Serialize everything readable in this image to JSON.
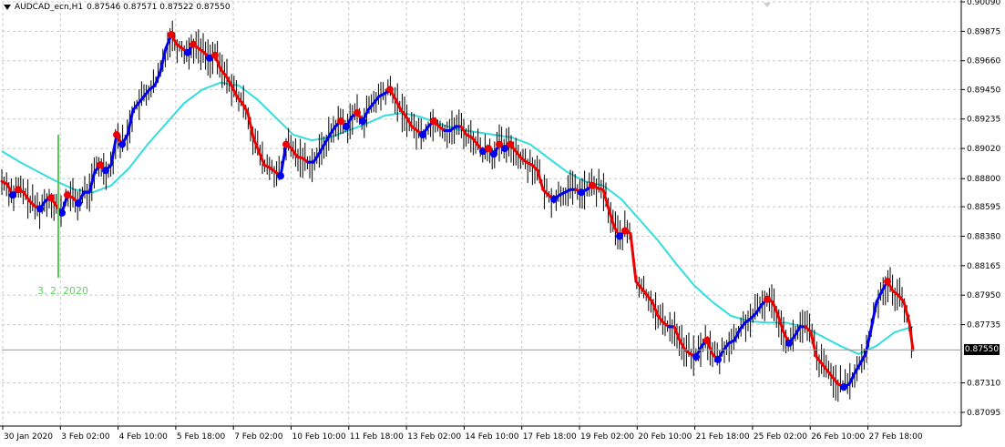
{
  "header": {
    "symbol_label": "AUDCAD_ecn,H1",
    "ohlc": "0.87546 0.87571 0.87522 0.87550"
  },
  "marker": {
    "label": "3. 2. 2020"
  },
  "current_price": "0.87550",
  "colors": {
    "up_trend": "#0000ee",
    "down_trend": "#ee0000",
    "bars": "#000000",
    "moving_average": "#33dddd",
    "marker_line": "#55cc55",
    "grid": "#c8c8c8",
    "axis": "#000000"
  },
  "chart_data": {
    "type": "line",
    "title": "",
    "xlabel": "",
    "ylabel": "",
    "ylim": [
      0.86995,
      0.9009
    ],
    "y_ticks": [
      "0.90090",
      "0.89875",
      "0.89660",
      "0.89450",
      "0.89235",
      "0.89020",
      "0.88800",
      "0.88595",
      "0.88380",
      "0.88165",
      "0.87950",
      "0.87735",
      "0.87310",
      "0.87095"
    ],
    "x_ticks": [
      "30 Jan 2020",
      "3 Feb 02:00",
      "4 Feb 10:00",
      "5 Feb 18:00",
      "7 Feb 02:00",
      "10 Feb 10:00",
      "11 Feb 18:00",
      "13 Feb 02:00",
      "14 Feb 10:00",
      "17 Feb 18:00",
      "19 Feb 02:00",
      "20 Feb 10:00",
      "21 Feb 18:00",
      "25 Feb 02:00",
      "26 Feb 10:00",
      "27 Feb 18:00"
    ],
    "price_points": [
      [
        0,
        0.8878
      ],
      [
        6,
        0.8876
      ],
      [
        12,
        0.8868
      ],
      [
        18,
        0.8872
      ],
      [
        24,
        0.887
      ],
      [
        30,
        0.8864
      ],
      [
        36,
        0.886
      ],
      [
        42,
        0.8858
      ],
      [
        48,
        0.8864
      ],
      [
        54,
        0.8866
      ],
      [
        60,
        0.886
      ],
      [
        66,
        0.8855
      ],
      [
        72,
        0.8868
      ],
      [
        78,
        0.8866
      ],
      [
        84,
        0.8862
      ],
      [
        90,
        0.887
      ],
      [
        96,
        0.887
      ],
      [
        102,
        0.8885
      ],
      [
        108,
        0.889
      ],
      [
        114,
        0.8886
      ],
      [
        120,
        0.889
      ],
      [
        126,
        0.8912
      ],
      [
        132,
        0.8905
      ],
      [
        138,
        0.8912
      ],
      [
        144,
        0.893
      ],
      [
        150,
        0.8935
      ],
      [
        156,
        0.894
      ],
      [
        162,
        0.8945
      ],
      [
        168,
        0.8948
      ],
      [
        174,
        0.8958
      ],
      [
        180,
        0.8975
      ],
      [
        186,
        0.8985
      ],
      [
        192,
        0.8978
      ],
      [
        198,
        0.8975
      ],
      [
        204,
        0.8972
      ],
      [
        210,
        0.8978
      ],
      [
        216,
        0.8975
      ],
      [
        222,
        0.8972
      ],
      [
        228,
        0.8968
      ],
      [
        234,
        0.897
      ],
      [
        240,
        0.896
      ],
      [
        246,
        0.8955
      ],
      [
        252,
        0.8948
      ],
      [
        258,
        0.894
      ],
      [
        264,
        0.8935
      ],
      [
        270,
        0.8928
      ],
      [
        276,
        0.891
      ],
      [
        282,
        0.89
      ],
      [
        288,
        0.889
      ],
      [
        294,
        0.8888
      ],
      [
        300,
        0.8885
      ],
      [
        306,
        0.8882
      ],
      [
        312,
        0.8905
      ],
      [
        318,
        0.8902
      ],
      [
        324,
        0.8896
      ],
      [
        330,
        0.8895
      ],
      [
        336,
        0.8892
      ],
      [
        342,
        0.8892
      ],
      [
        348,
        0.8898
      ],
      [
        354,
        0.8905
      ],
      [
        360,
        0.8912
      ],
      [
        366,
        0.8918
      ],
      [
        372,
        0.8922
      ],
      [
        378,
        0.8918
      ],
      [
        384,
        0.8925
      ],
      [
        390,
        0.8928
      ],
      [
        396,
        0.8922
      ],
      [
        402,
        0.893
      ],
      [
        408,
        0.8935
      ],
      [
        414,
        0.894
      ],
      [
        420,
        0.8942
      ],
      [
        426,
        0.8945
      ],
      [
        432,
        0.8938
      ],
      [
        438,
        0.893
      ],
      [
        444,
        0.8925
      ],
      [
        450,
        0.8918
      ],
      [
        456,
        0.8915
      ],
      [
        462,
        0.8912
      ],
      [
        468,
        0.8918
      ],
      [
        474,
        0.8922
      ],
      [
        480,
        0.8918
      ],
      [
        486,
        0.8915
      ],
      [
        492,
        0.8915
      ],
      [
        498,
        0.8918
      ],
      [
        504,
        0.8918
      ],
      [
        510,
        0.8912
      ],
      [
        516,
        0.891
      ],
      [
        522,
        0.8905
      ],
      [
        528,
        0.89
      ],
      [
        534,
        0.8902
      ],
      [
        540,
        0.8898
      ],
      [
        546,
        0.8905
      ],
      [
        552,
        0.8902
      ],
      [
        558,
        0.8905
      ],
      [
        564,
        0.89
      ],
      [
        570,
        0.8895
      ],
      [
        576,
        0.8892
      ],
      [
        582,
        0.889
      ],
      [
        588,
        0.8886
      ],
      [
        594,
        0.8872
      ],
      [
        600,
        0.8868
      ],
      [
        606,
        0.8865
      ],
      [
        612,
        0.8868
      ],
      [
        618,
        0.887
      ],
      [
        624,
        0.8872
      ],
      [
        630,
        0.8872
      ],
      [
        636,
        0.887
      ],
      [
        642,
        0.8872
      ],
      [
        648,
        0.8875
      ],
      [
        654,
        0.8873
      ],
      [
        660,
        0.8872
      ],
      [
        666,
        0.8858
      ],
      [
        672,
        0.8845
      ],
      [
        678,
        0.8838
      ],
      [
        684,
        0.8842
      ],
      [
        690,
        0.884
      ],
      [
        696,
        0.8805
      ],
      [
        702,
        0.88
      ],
      [
        708,
        0.8795
      ],
      [
        714,
        0.879
      ],
      [
        720,
        0.878
      ],
      [
        726,
        0.8775
      ],
      [
        732,
        0.8772
      ],
      [
        738,
        0.8772
      ],
      [
        744,
        0.8762
      ],
      [
        750,
        0.8755
      ],
      [
        756,
        0.8752
      ],
      [
        762,
        0.875
      ],
      [
        768,
        0.8758
      ],
      [
        774,
        0.8762
      ],
      [
        780,
        0.8752
      ],
      [
        786,
        0.8748
      ],
      [
        792,
        0.8755
      ],
      [
        798,
        0.876
      ],
      [
        804,
        0.8762
      ],
      [
        810,
        0.877
      ],
      [
        816,
        0.8775
      ],
      [
        822,
        0.8778
      ],
      [
        828,
        0.8782
      ],
      [
        834,
        0.8788
      ],
      [
        840,
        0.8792
      ],
      [
        846,
        0.879
      ],
      [
        852,
        0.878
      ],
      [
        858,
        0.8768
      ],
      [
        864,
        0.876
      ],
      [
        870,
        0.8765
      ],
      [
        876,
        0.8772
      ],
      [
        882,
        0.8772
      ],
      [
        888,
        0.8768
      ],
      [
        894,
        0.875
      ],
      [
        900,
        0.8745
      ],
      [
        906,
        0.874
      ],
      [
        912,
        0.8735
      ],
      [
        918,
        0.873
      ],
      [
        924,
        0.8728
      ],
      [
        930,
        0.873
      ],
      [
        936,
        0.8738
      ],
      [
        942,
        0.8745
      ],
      [
        948,
        0.8752
      ],
      [
        954,
        0.877
      ],
      [
        960,
        0.879
      ],
      [
        966,
        0.8798
      ],
      [
        972,
        0.8805
      ],
      [
        978,
        0.8798
      ],
      [
        984,
        0.8795
      ],
      [
        990,
        0.879
      ],
      [
        996,
        0.8775
      ],
      [
        1000,
        0.8755
      ]
    ],
    "series": [
      {
        "name": "",
        "kind": "moving_average",
        "points": [
          [
            0,
            0.89
          ],
          [
            20,
            0.8892
          ],
          [
            40,
            0.8885
          ],
          [
            60,
            0.8878
          ],
          [
            80,
            0.8872
          ],
          [
            100,
            0.887
          ],
          [
            120,
            0.8875
          ],
          [
            140,
            0.8888
          ],
          [
            160,
            0.8905
          ],
          [
            180,
            0.892
          ],
          [
            200,
            0.8935
          ],
          [
            220,
            0.8945
          ],
          [
            240,
            0.895
          ],
          [
            260,
            0.8948
          ],
          [
            280,
            0.8938
          ],
          [
            300,
            0.8925
          ],
          [
            320,
            0.8912
          ],
          [
            340,
            0.8908
          ],
          [
            360,
            0.891
          ],
          [
            380,
            0.8915
          ],
          [
            400,
            0.892
          ],
          [
            420,
            0.8926
          ],
          [
            440,
            0.8928
          ],
          [
            460,
            0.8925
          ],
          [
            480,
            0.892
          ],
          [
            500,
            0.8916
          ],
          [
            520,
            0.8914
          ],
          [
            540,
            0.8912
          ],
          [
            560,
            0.891
          ],
          [
            580,
            0.8905
          ],
          [
            600,
            0.8895
          ],
          [
            620,
            0.8885
          ],
          [
            640,
            0.8878
          ],
          [
            660,
            0.8875
          ],
          [
            680,
            0.8865
          ],
          [
            700,
            0.885
          ],
          [
            720,
            0.8835
          ],
          [
            740,
            0.8818
          ],
          [
            760,
            0.8802
          ],
          [
            780,
            0.879
          ],
          [
            800,
            0.878
          ],
          [
            820,
            0.8776
          ],
          [
            840,
            0.8775
          ],
          [
            860,
            0.8775
          ],
          [
            880,
            0.8772
          ],
          [
            900,
            0.8765
          ],
          [
            920,
            0.8758
          ],
          [
            940,
            0.8752
          ],
          [
            960,
            0.8758
          ],
          [
            980,
            0.8768
          ],
          [
            1000,
            0.8772
          ]
        ]
      }
    ],
    "x_range": [
      0,
      1060
    ],
    "grid": true,
    "legend": "none"
  }
}
